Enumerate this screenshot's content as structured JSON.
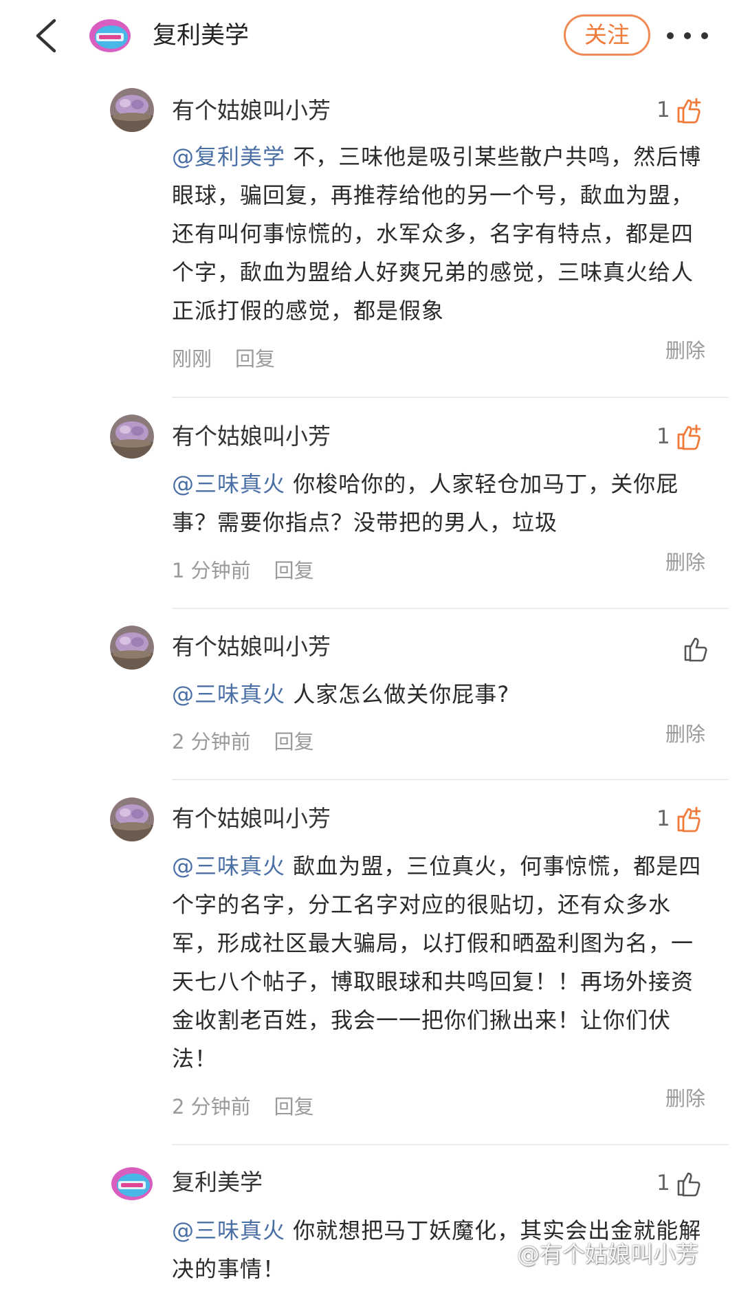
{
  "header": {
    "title": "复利美学",
    "follow_label": "关注",
    "back_icon": "chevron-left-icon",
    "more_icon": "more-dots-icon"
  },
  "comments": [
    {
      "author": "有个姑娘叫小芳",
      "likes": "1",
      "liked": true,
      "mention": "@复利美学",
      "text": " 不，三味他是吸引某些散户共鸣，然后博眼球，骗回复，再推荐给他的另一个号，歃血为盟，还有叫何事惊慌的，水军众多，名字有特点，都是四个字，歃血为盟给人好爽兄弟的感觉，三味真火给人正派打假的感觉，都是假象",
      "time": "刚刚",
      "reply": "回复",
      "delete": "删除"
    },
    {
      "author": "有个姑娘叫小芳",
      "likes": "1",
      "liked": true,
      "mention": "@三味真火",
      "text": " 你梭哈你的，人家轻仓加马丁，关你屁事？需要你指点？没带把的男人，垃圾",
      "time": "1 分钟前",
      "reply": "回复",
      "delete": "删除"
    },
    {
      "author": "有个姑娘叫小芳",
      "likes": "",
      "liked": false,
      "mention": "@三味真火",
      "text": " 人家怎么做关你屁事?",
      "time": "2 分钟前",
      "reply": "回复",
      "delete": "删除"
    },
    {
      "author": "有个姑娘叫小芳",
      "likes": "1",
      "liked": true,
      "mention": "@三味真火",
      "text": " 歃血为盟，三位真火，何事惊慌，都是四个字的名字，分工名字对应的很贴切，还有众多水军，形成社区最大骗局，以打假和晒盈利图为名，一天七八个帖子，博取眼球和共鸣回复！！再场外接资金收割老百姓，我会一一把你们揪出来！让你们伏法！",
      "time": "2 分钟前",
      "reply": "回复",
      "delete": "删除"
    },
    {
      "author": "复利美学",
      "likes": "1",
      "liked": false,
      "mention": "@三味真火",
      "text": " 你就想把马丁妖魔化，其实会出金就能解决的事情！",
      "time": "",
      "reply": "",
      "delete": ""
    }
  ],
  "watermark": "@有个姑娘叫小芳",
  "colors": {
    "accent": "#f07a3a",
    "mention": "#4a6fa5",
    "meta": "#9a9a9a"
  }
}
